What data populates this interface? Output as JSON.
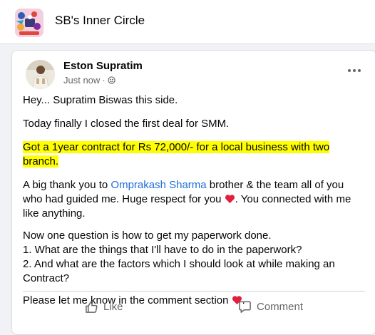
{
  "header": {
    "group_name": "SB's Inner Circle",
    "group_icon": "group-cover-thumbnail"
  },
  "post": {
    "author": "Eston Supratim",
    "timestamp": "Just now",
    "separator": " · ",
    "privacy_icon": "globe-icon",
    "more_icon": "more-options-icon",
    "body": {
      "line1": "Hey... Supratim Biswas this side.",
      "line2": "Today finally I closed the first deal for SMM.",
      "highlight_line1": "Got a 1year contract for Rs 72,000/- for a local business with two",
      "highlight_line2": "branch.",
      "thanks_prefix": "A big thank you to ",
      "mention": "Omprakash Sharma",
      "thanks_line1_rest": "  brother & the team all of you",
      "thanks_line2": "who had guided me. Huge respect for you ",
      "thanks_line2_rest": ". You connected with me",
      "thanks_line3": "like anything.",
      "question_intro": "Now one question is how to get my paperwork done.",
      "question1": "1. What are the things that I'll have to do in the paperwork?",
      "question2a": "2. And what are the factors which I should look at while making an",
      "question2b": "Contract?",
      "closing": "Please let me know in the comment section ",
      "closing_end": "."
    },
    "highlight_color": "#ffff00",
    "mention_color": "#216fdb"
  },
  "actions": {
    "like_label": "Like",
    "comment_label": "Comment"
  }
}
